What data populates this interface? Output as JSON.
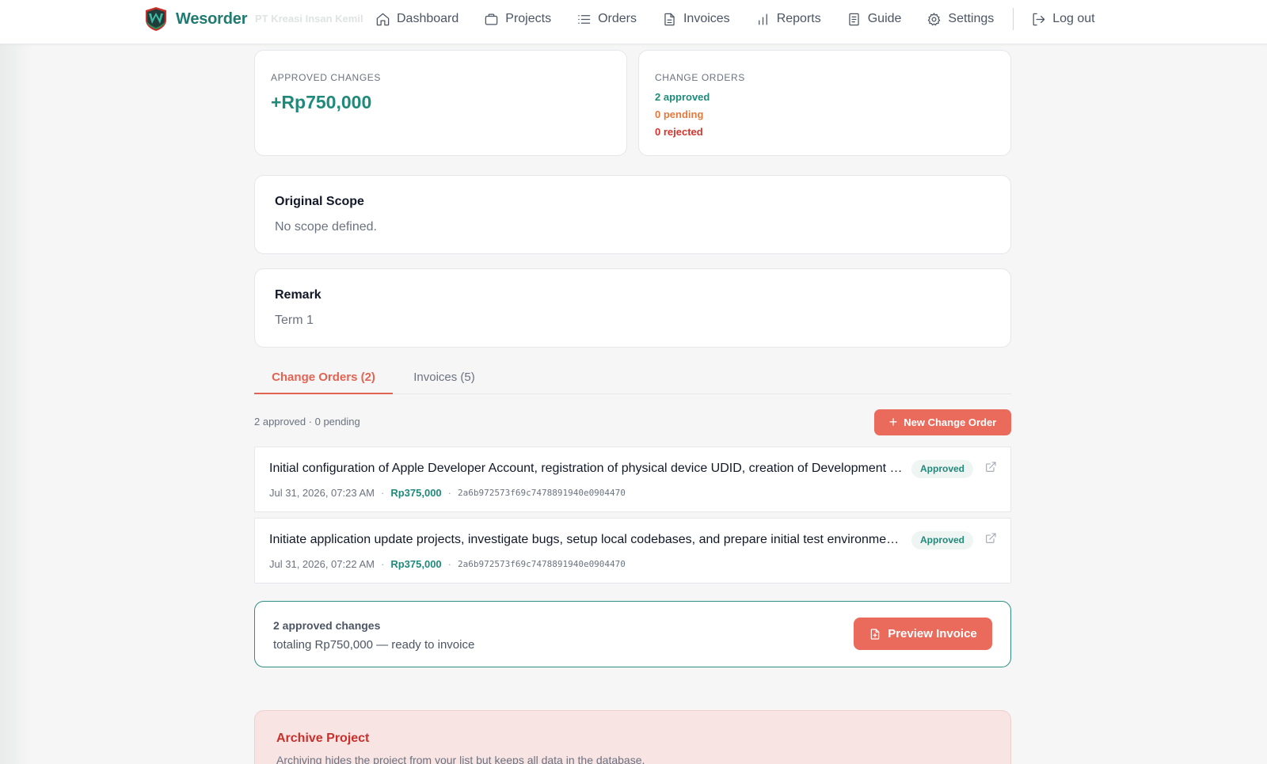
{
  "brand": {
    "name": "Wesorder",
    "org_ghost": "PT Kreasi Insan Kemil",
    "color": "#1f7a70"
  },
  "nav": {
    "items": [
      {
        "label": "Dashboard",
        "icon": "home-icon"
      },
      {
        "label": "Projects",
        "icon": "briefcase-icon"
      },
      {
        "label": "Orders",
        "icon": "list-icon"
      },
      {
        "label": "Invoices",
        "icon": "document-icon"
      },
      {
        "label": "Reports",
        "icon": "bar-chart-icon"
      },
      {
        "label": "Guide",
        "icon": "book-icon"
      },
      {
        "label": "Settings",
        "icon": "gear-icon"
      }
    ],
    "logout": {
      "label": "Log out",
      "icon": "logout-icon"
    }
  },
  "stats": {
    "approved_changes": {
      "label": "APPROVED CHANGES",
      "value": "+Rp750,000"
    },
    "change_orders": {
      "label": "CHANGE ORDERS",
      "approved": "2 approved",
      "pending": "0 pending",
      "rejected": "0 rejected"
    }
  },
  "scope": {
    "title": "Original Scope",
    "text": "No scope defined."
  },
  "remark": {
    "title": "Remark",
    "text": "Term 1"
  },
  "tabs": [
    {
      "label": "Change Orders (2)",
      "active": true
    },
    {
      "label": "Invoices (5)",
      "active": false
    }
  ],
  "change_orders_panel": {
    "summary": "2 approved · 0 pending",
    "new_button": "New Change Order",
    "rows": [
      {
        "title": "Initial configuration of Apple Developer Account, registration of physical device UDID, creation of Development Certificate and Provisioning Profile",
        "status": "Approved",
        "date": "Jul 31, 2026, 07:23 AM",
        "amount": "Rp375,000",
        "hash": "2a6b972573f69c7478891940e0904470"
      },
      {
        "title": "Initiate application update projects, investigate bugs, setup local codebases, and prepare initial test environments",
        "status": "Approved",
        "date": "Jul 31, 2026, 07:22 AM",
        "amount": "Rp375,000",
        "hash": "2a6b972573f69c7478891940e0904470"
      }
    ]
  },
  "ready_invoice": {
    "title": "2 approved changes",
    "text": "totaling Rp750,000 — ready to invoice",
    "button": "Preview Invoice"
  },
  "archive": {
    "title": "Archive Project",
    "text": "Archiving hides the project from your list but keeps all data in the database."
  },
  "colors": {
    "accent": "#ea6a5c",
    "teal": "#1f8a7a",
    "pending": "#e07a3f",
    "rejected": "#d4342c"
  }
}
